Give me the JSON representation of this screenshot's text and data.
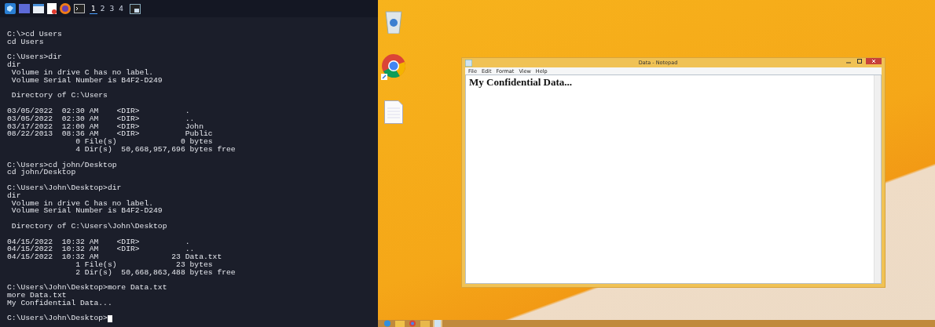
{
  "top_panel": {
    "workspaces": [
      {
        "label": "1",
        "selected": true
      },
      {
        "label": "2",
        "selected": false
      },
      {
        "label": "3",
        "selected": false
      },
      {
        "label": "4",
        "selected": false
      }
    ]
  },
  "terminal": {
    "blocks": [
      [
        "C:\\>cd Users",
        "cd Users"
      ],
      [
        "C:\\Users>dir",
        "dir",
        " Volume in drive C has no label.",
        " Volume Serial Number is B4F2-D249"
      ],
      [
        " Directory of C:\\Users"
      ],
      [
        "03/05/2022  02:30 AM    <DIR>          .",
        "03/05/2022  02:30 AM    <DIR>          ..",
        "03/17/2022  12:00 AM    <DIR>          John",
        "08/22/2013  08:36 AM    <DIR>          Public",
        "               0 File(s)              0 bytes",
        "               4 Dir(s)  50,668,957,696 bytes free"
      ],
      [
        "C:\\Users>cd john/Desktop",
        "cd john/Desktop"
      ],
      [
        "C:\\Users\\John\\Desktop>dir",
        "dir",
        " Volume in drive C has no label.",
        " Volume Serial Number is B4F2-D249"
      ],
      [
        " Directory of C:\\Users\\John\\Desktop"
      ],
      [
        "04/15/2022  10:32 AM    <DIR>          .",
        "04/15/2022  10:32 AM    <DIR>          ..",
        "04/15/2022  10:32 AM                23 Data.txt",
        "               1 File(s)             23 bytes",
        "               2 Dir(s)  50,668,863,488 bytes free"
      ],
      [
        "C:\\Users\\John\\Desktop>more Data.txt",
        "more Data.txt",
        "My Confidential Data..."
      ],
      [
        "C:\\Users\\John\\Desktop>"
      ]
    ]
  },
  "notepad": {
    "title": "Data - Notepad",
    "menu": [
      "File",
      "Edit",
      "Format",
      "View",
      "Help"
    ],
    "content": "My Confidential Data..."
  }
}
